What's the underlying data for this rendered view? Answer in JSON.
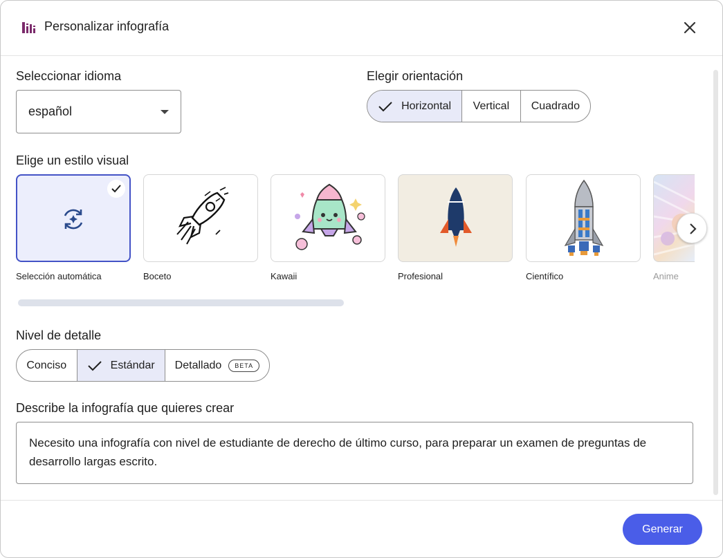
{
  "dialog": {
    "title": "Personalizar infografía",
    "app_icon": "infographic-bars-icon",
    "close_icon": "close-icon"
  },
  "language": {
    "label": "Seleccionar idioma",
    "value": "español"
  },
  "orientation": {
    "label": "Elegir orientación",
    "options": [
      "Horizontal",
      "Vertical",
      "Cuadrado"
    ],
    "selected": "Horizontal"
  },
  "visual_style": {
    "label": "Elige un estilo visual",
    "items": [
      {
        "label": "Selección automática",
        "icon": "auto-refresh-sparkle-icon",
        "selected": true
      },
      {
        "label": "Boceto",
        "icon": "sketch-rocket-icon",
        "selected": false
      },
      {
        "label": "Kawaii",
        "icon": "kawaii-rocket-icon",
        "selected": false
      },
      {
        "label": "Profesional",
        "icon": "professional-rocket-icon",
        "selected": false
      },
      {
        "label": "Científico",
        "icon": "scientific-rocket-icon",
        "selected": false
      },
      {
        "label": "Anime",
        "icon": "anime-style-icon",
        "selected": false
      }
    ],
    "next_icon": "chevron-right-icon"
  },
  "detail": {
    "label": "Nivel de detalle",
    "options": [
      "Conciso",
      "Estándar",
      "Detallado"
    ],
    "selected": "Estándar",
    "beta_badge": "BETA"
  },
  "description": {
    "label": "Describe la infografía que quieres crear",
    "value": "Necesito una infografía con nivel de estudiante de derecho de último curso, para preparar un examen de preguntas de desarrollo largas escrito."
  },
  "actions": {
    "generate": "Generar"
  },
  "colors": {
    "accent": "#4a5de8",
    "selected_bg": "#e8eaf8",
    "brand_icon": "#7b2a6b"
  }
}
